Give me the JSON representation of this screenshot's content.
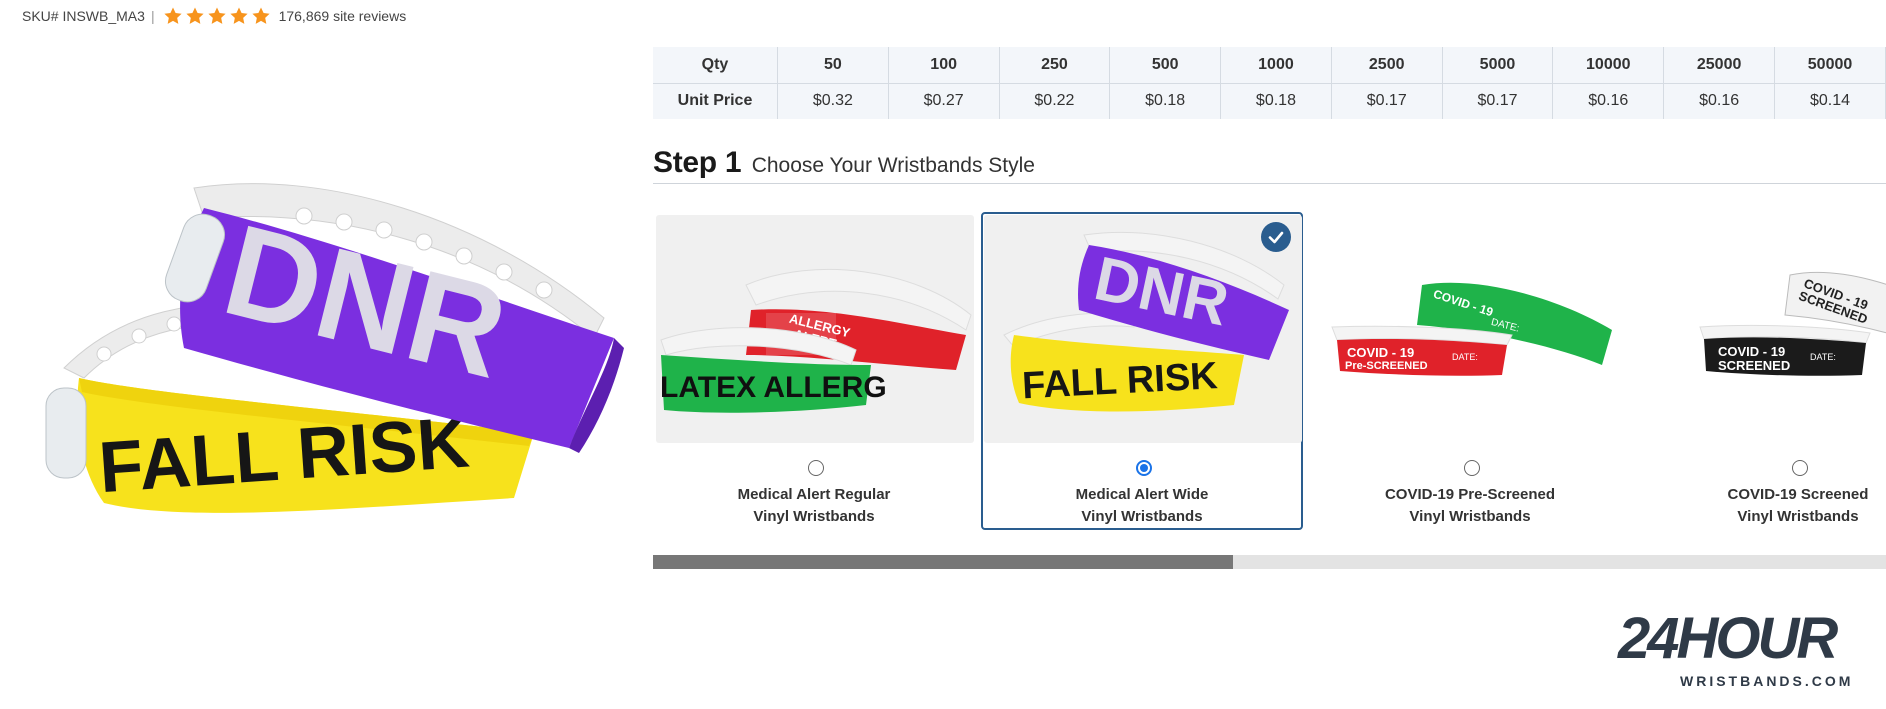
{
  "header": {
    "sku": "SKU# INSWB_MA3",
    "separator": "|",
    "rating_stars": 5,
    "reviews": "176,869 site reviews"
  },
  "main_image": {
    "top_band_text": "DNR",
    "bottom_band_text": "FALL RISK"
  },
  "price_table": {
    "qty_label": "Qty",
    "price_label": "Unit Price",
    "quantities": [
      "50",
      "100",
      "250",
      "500",
      "1000",
      "2500",
      "5000",
      "10000",
      "25000",
      "50000"
    ],
    "prices": [
      "$0.32",
      "$0.27",
      "$0.22",
      "$0.18",
      "$0.18",
      "$0.17",
      "$0.17",
      "$0.16",
      "$0.16",
      "$0.14"
    ]
  },
  "step": {
    "number": "Step 1",
    "description": "Choose Your Wristbands Style"
  },
  "options": [
    {
      "line1": "Medical Alert Regular",
      "line2": "Vinyl Wristbands",
      "selected": false,
      "img_text_a": "LATEX ALLERG",
      "img_text_b": "ALLERGY",
      "img_text_c": "ALERT"
    },
    {
      "line1": "Medical Alert Wide",
      "line2": "Vinyl Wristbands",
      "selected": true,
      "img_text_a": "DNR",
      "img_text_b": "FALL RISK"
    },
    {
      "line1": "COVID-19 Pre-Screened",
      "line2": "Vinyl Wristbands",
      "selected": false,
      "img_text_a": "COVID - 19",
      "img_text_b": "Pre-SCREENED",
      "img_text_c": "DATE:"
    },
    {
      "line1": "COVID-19 Screened",
      "line2": "Vinyl Wristbands",
      "selected": false,
      "img_text_a": "COVID - 19",
      "img_text_b": "SCREENED",
      "img_text_c": "DATE:"
    }
  ],
  "scrollbar": {
    "position_fraction": 0.47
  },
  "logo": {
    "line1": "24HOUR",
    "line2": "WRISTBANDS.COM"
  },
  "colors": {
    "accent": "#2a5d8f",
    "radio_selected": "#1a73e8",
    "star": "#f7941d",
    "purple": "#7b2fe0",
    "yellow": "#f7e21c",
    "red": "#e0222a",
    "green": "#1fb34a",
    "logo": "#2f3a47"
  }
}
